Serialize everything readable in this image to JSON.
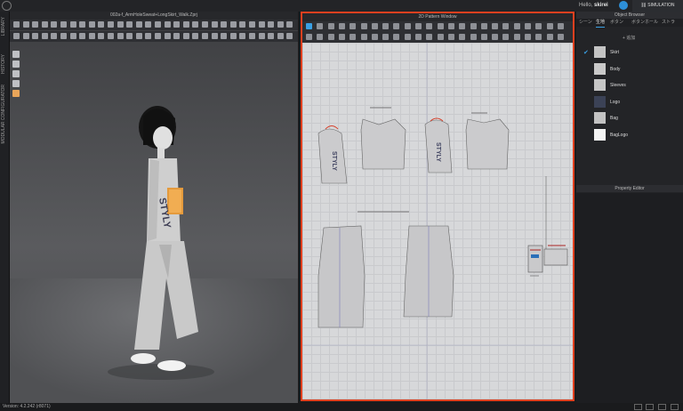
{
  "app": {
    "greeting_prefix": "Hello,",
    "username": "skirei",
    "simulation_label": "SIMULATION"
  },
  "side_tabs": [
    "LIBRARY",
    "HISTORY",
    "MODULAR CONFIGURATOR"
  ],
  "viewport": {
    "title": "002a-f_ArmHoleSweat+LongSkirt_Walk.Zprj",
    "print_text": "STYLY"
  },
  "pattern_window": {
    "title": "2D Pattern Window",
    "print_text": "STYLY"
  },
  "object_browser": {
    "title": "Object Browser",
    "tabs": [
      "シーン",
      "生地",
      "ボタン",
      "ボタンホール",
      "ストラ"
    ],
    "active_tab": 1,
    "add_label": "+ 追加",
    "items": [
      {
        "name": "Skirt",
        "checked": true,
        "color": "#c4c4c4"
      },
      {
        "name": "Body",
        "checked": false,
        "color": "#c9c9c9"
      },
      {
        "name": "Sleeves",
        "checked": false,
        "color": "#c6c6c6"
      },
      {
        "name": "Logo",
        "checked": false,
        "color": "#3b4256"
      },
      {
        "name": "Bag",
        "checked": false,
        "color": "#c2c2c2"
      },
      {
        "name": "BagLogo",
        "checked": false,
        "color": "#f4f4f4"
      }
    ]
  },
  "property_editor": {
    "title": "Property Editor"
  },
  "status": {
    "version": "Version: 4.2.242 (r8071)"
  }
}
